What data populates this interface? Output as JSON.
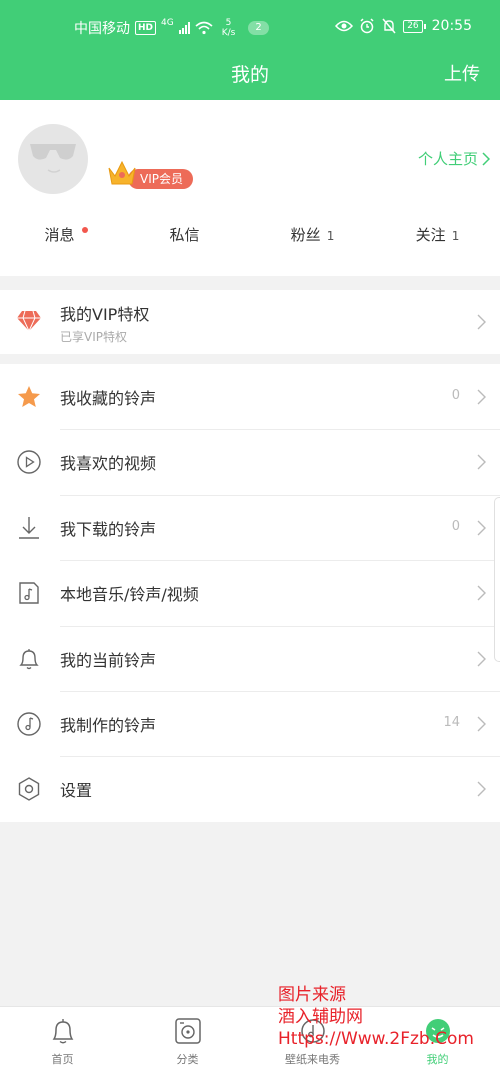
{
  "status_bar": {
    "carrier": "中国移动",
    "hd": "HD",
    "signal_gen": "4G",
    "speed_value": "5",
    "speed_unit": "K/s",
    "notification_count": "2",
    "battery": "26",
    "time": "20:55"
  },
  "nav": {
    "title": "我的",
    "upload": "上传"
  },
  "profile": {
    "vip_label": "VIP会员",
    "home_link": "个人主页",
    "stats": [
      {
        "label": "消息",
        "count": ""
      },
      {
        "label": "私信",
        "count": ""
      },
      {
        "label": "粉丝",
        "count": "1"
      },
      {
        "label": "关注",
        "count": "1"
      }
    ]
  },
  "vip_row": {
    "title": "我的VIP特权",
    "subtitle": "已享VIP特权"
  },
  "menu": [
    {
      "icon": "star-icon",
      "label": "我收藏的铃声",
      "count": "0"
    },
    {
      "icon": "play-circle-icon",
      "label": "我喜欢的视频",
      "count": ""
    },
    {
      "icon": "download-icon",
      "label": "我下载的铃声",
      "count": "0"
    },
    {
      "icon": "music-file-icon",
      "label": "本地音乐/铃声/视频",
      "count": ""
    },
    {
      "icon": "bell-icon",
      "label": "我的当前铃声",
      "count": ""
    },
    {
      "icon": "music-note-icon",
      "label": "我制作的铃声",
      "count": "14"
    },
    {
      "icon": "settings-icon",
      "label": "设置",
      "count": ""
    }
  ],
  "bottom_nav": [
    {
      "icon": "bell-home-icon",
      "label": "首页"
    },
    {
      "icon": "category-icon",
      "label": "分类"
    },
    {
      "icon": "wallpaper-icon",
      "label": "壁纸来电秀"
    },
    {
      "icon": "profile-icon",
      "label": "我的"
    }
  ],
  "watermark": {
    "line1": "图片来源",
    "line2": "酒入辅助网",
    "line3": "Https://Www.2Fzb.Com"
  },
  "colors": {
    "brand": "#41ce77",
    "vip": "#ed6b58",
    "dot": "#f2574d",
    "watermark": "#e8222a"
  }
}
